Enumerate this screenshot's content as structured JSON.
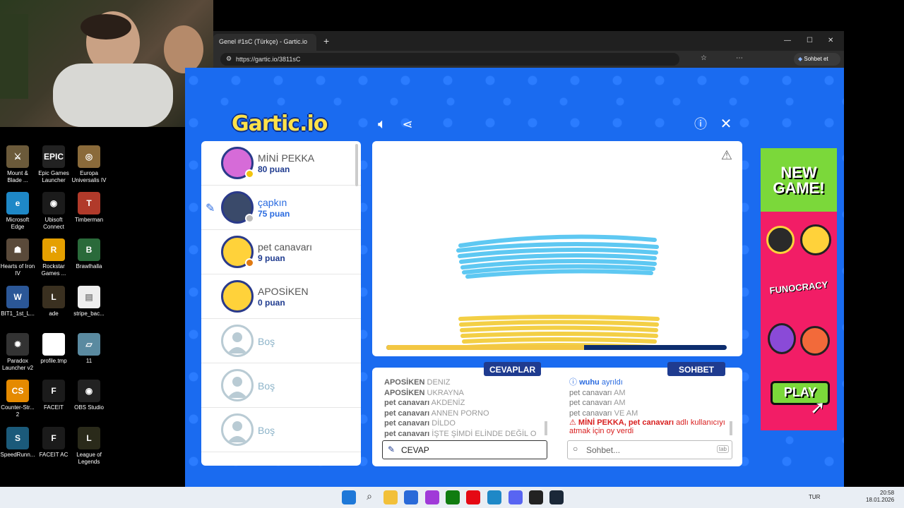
{
  "desktop": {
    "icons": [
      {
        "label": "Mount & Blade ...",
        "color": "#6b5a3a",
        "glyph": "⚔"
      },
      {
        "label": "Epic Games Launcher",
        "color": "#222222",
        "glyph": "EPIC"
      },
      {
        "label": "Europa Universalis IV",
        "color": "#8a6a3a",
        "glyph": "◎"
      },
      {
        "label": "Microsoft Edge",
        "color": "#1e88c7",
        "glyph": "e"
      },
      {
        "label": "Ubisoft Connect",
        "color": "#1b1b1b",
        "glyph": "◉"
      },
      {
        "label": "Timberman",
        "color": "#b13a2a",
        "glyph": "T"
      },
      {
        "label": "Hearts of Iron IV",
        "color": "#5a4a3a",
        "glyph": "☗"
      },
      {
        "label": "Rockstar Games ...",
        "color": "#e5a000",
        "glyph": "R"
      },
      {
        "label": "Brawlhalla",
        "color": "#2a6a3a",
        "glyph": "B"
      },
      {
        "label": "BIT1_1st_L...",
        "color": "#2b5797",
        "glyph": "W"
      },
      {
        "label": "ade",
        "color": "#3a3020",
        "glyph": "L"
      },
      {
        "label": "stripe_bac...",
        "color": "#eeeeee",
        "glyph": "▤"
      },
      {
        "label": "Paradox Launcher v2",
        "color": "#333333",
        "glyph": "✹"
      },
      {
        "label": "profile.tmp",
        "color": "#ffffff",
        "glyph": " "
      },
      {
        "label": "11",
        "color": "#5a8aa0",
        "glyph": "▱"
      },
      {
        "label": "Counter-Str... 2",
        "color": "#e58a00",
        "glyph": "CS"
      },
      {
        "label": "FACEIT",
        "color": "#1b1b1b",
        "glyph": "F"
      },
      {
        "label": "OBS Studio",
        "color": "#222222",
        "glyph": "◉"
      },
      {
        "label": "SpeedRunn...",
        "color": "#1b5a7a",
        "glyph": "S"
      },
      {
        "label": "FACEIT AC",
        "color": "#1b1b1b",
        "glyph": "F"
      },
      {
        "label": "League of Legends",
        "color": "#2a2a1a",
        "glyph": "L"
      }
    ]
  },
  "browser": {
    "tab_title": "Genel #1sC (Türkçe) - Gartic.io",
    "url": "https://gartic.io/3811sC",
    "copilot_label": "Sohbet et"
  },
  "game": {
    "logo": "Gartic.io",
    "players": [
      {
        "name": "MİNİ PEKKA",
        "score": "80 puan",
        "status_color": "#f2c40f",
        "avatar_color": "#d66bd8",
        "drawing": false
      },
      {
        "name": "çapkın",
        "score": "75 puan",
        "status_color": "#bbbbbb",
        "avatar_color": "#3a4a6a",
        "drawing": true
      },
      {
        "name": "pet canavarı",
        "score": "9 puan",
        "status_color": "#e07a12",
        "avatar_color": "#ffd23a",
        "drawing": false
      },
      {
        "name": "APOSİKEN",
        "score": "0 puan",
        "status_color": "",
        "avatar_color": "#ffd23a",
        "drawing": false
      }
    ],
    "empty_slots": [
      "Boş",
      "Boş",
      "Boş"
    ],
    "timer_progress": 0.58,
    "answers_header": "CEVAPLAR",
    "chat_header": "SOHBET",
    "answers": [
      {
        "user": "APOSİKEN",
        "text": "DENIZ"
      },
      {
        "user": "APOSİKEN",
        "text": "UKRAYNA"
      },
      {
        "user": "pet canavarı",
        "text": "AKDENİZ"
      },
      {
        "user": "pet canavarı",
        "text": "ANNEN PORNO"
      },
      {
        "user": "pet canavarı",
        "text": "DİLDO"
      },
      {
        "user": "pet canavarı",
        "text": "İŞTE ŞİMDİ ELİNDE DEĞİL O"
      }
    ],
    "chat": {
      "left_notice_user": "wuhu",
      "left_notice_text": "ayrıldı",
      "messages": [
        {
          "user": "pet canavarı",
          "text": "AM"
        },
        {
          "user": "pet canavarı",
          "text": "AM"
        },
        {
          "user": "pet canavarı",
          "text": "VE AM"
        }
      ],
      "vote_users": "MİNİ PEKKA, pet canavarı",
      "vote_text": "adlı kullanıcıyı atmak için oy verdi"
    },
    "answer_input_value": "CEVAP",
    "chat_input_placeholder": "Sohbet...",
    "chat_tab_hint": "tab"
  },
  "ad": {
    "line1": "NEW",
    "line2": "GAME!",
    "brand": "FUNOCRACY",
    "play": "PLAY"
  },
  "taskbar": {
    "lang": "TUR",
    "time": "20:58",
    "date": "18.01.2026"
  },
  "colors": {
    "gartic_blue": "#1a6bf0",
    "navy": "#1f3b8f",
    "drawing_blue": "#5ec8f2",
    "drawing_yellow": "#f3cf45",
    "alert_red": "#d81e1e"
  }
}
